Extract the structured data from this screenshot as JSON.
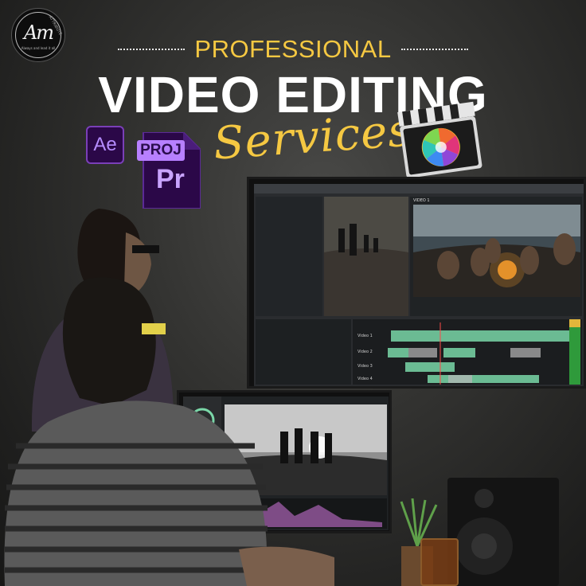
{
  "logo": {
    "monogram": "Am",
    "tagline": "Always and lead it all",
    "side_text": "ATTRIBUTE"
  },
  "heading": {
    "eyebrow": "PROFESSIONAL",
    "headline": "VIDEO EDITING",
    "script": "Services"
  },
  "icons": {
    "after_effects": "Ae",
    "project_tag": "PROJ",
    "premiere": "Pr",
    "final_cut": "final-cut-pro-icon"
  },
  "editor": {
    "program_tab": "VIDEO 1",
    "track_labels": [
      "Video 1",
      "Video 2",
      "Video 3",
      "Video 4"
    ]
  },
  "colors": {
    "accent": "#f5c842",
    "headline": "#ffffff",
    "background": "#2f2f2e",
    "adobe_purple": "#b780ff",
    "timeline_clip": "#7ad7a8"
  }
}
